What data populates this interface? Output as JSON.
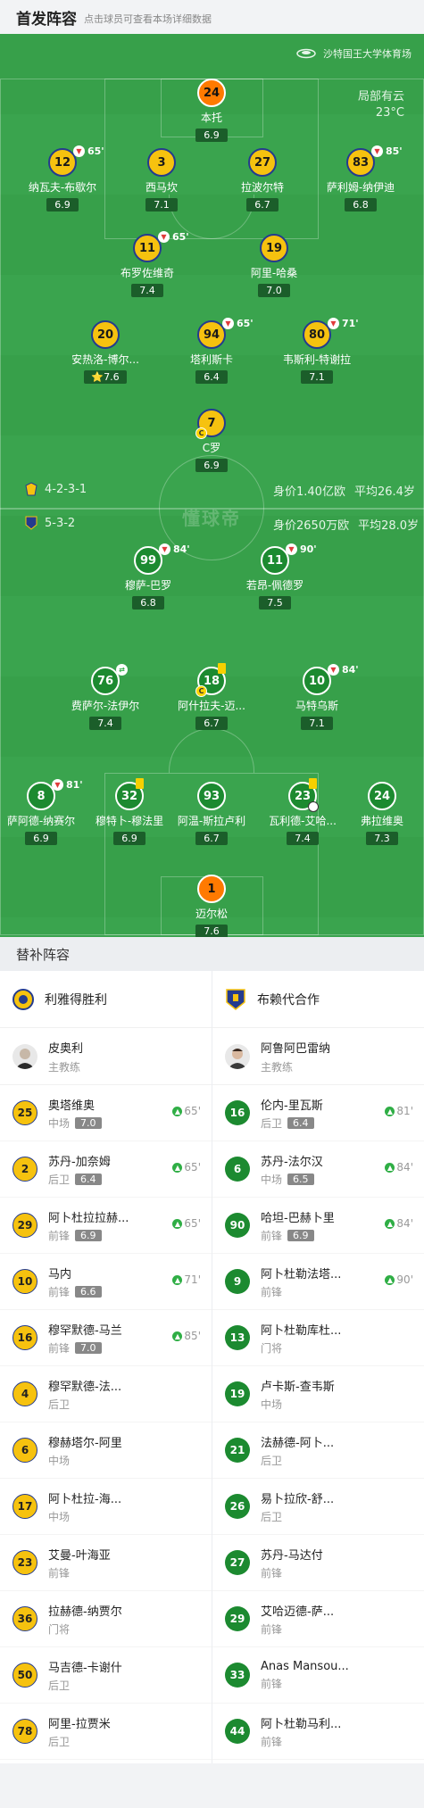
{
  "header": {
    "title": "首发阵容",
    "subtitle": "点击球员可查看本场详细数据"
  },
  "venue": {
    "name": "沙特国王大学体育场",
    "weather": "局部有云",
    "temp": "23°C"
  },
  "watermark": "懂球帝",
  "home_team": {
    "formation": "4-2-3-1",
    "value": "身价1.40亿欧",
    "age": "平均26.4岁"
  },
  "away_team": {
    "formation": "5-3-2",
    "value": "身价2650万欧",
    "age": "平均28.0岁"
  },
  "pitch_home": [
    {
      "num": "24",
      "name": "本托",
      "rating": "6.9",
      "style": "gk-away"
    },
    {
      "num": "12",
      "name": "纳瓦夫-布歇尔",
      "rating": "6.9",
      "style": "yb",
      "sub": "65'"
    },
    {
      "num": "3",
      "name": "西马坎",
      "rating": "7.1",
      "style": "yb"
    },
    {
      "num": "27",
      "name": "拉波尔特",
      "rating": "6.7",
      "style": "yb"
    },
    {
      "num": "83",
      "name": "萨利姆-纳伊迪",
      "rating": "6.8",
      "style": "yb",
      "sub": "85'"
    },
    {
      "num": "11",
      "name": "布罗佐维奇",
      "rating": "7.4",
      "style": "yb",
      "sub": "65'"
    },
    {
      "num": "19",
      "name": "阿里-哈桑",
      "rating": "7.0",
      "style": "yb"
    },
    {
      "num": "20",
      "name": "安热洛-博尔...",
      "rating": "7.6",
      "style": "yb",
      "star": "true"
    },
    {
      "num": "94",
      "name": "塔利斯卡",
      "rating": "6.4",
      "style": "yb",
      "sub": "65'"
    },
    {
      "num": "80",
      "name": "韦斯利-特谢拉",
      "rating": "7.1",
      "style": "yb",
      "sub": "71'"
    },
    {
      "num": "7",
      "name": "C罗",
      "rating": "6.9",
      "style": "yb",
      "captain": "C"
    }
  ],
  "pitch_away": [
    {
      "num": "99",
      "name": "穆萨-巴罗",
      "rating": "6.8",
      "style": "green",
      "sub": "84'"
    },
    {
      "num": "11",
      "name": "若昂-佩德罗",
      "rating": "7.5",
      "style": "green",
      "sub": "90'"
    },
    {
      "num": "76",
      "name": "费萨尔-法伊尔",
      "rating": "7.4",
      "style": "green",
      "subin": "true"
    },
    {
      "num": "18",
      "name": "阿什拉夫-迈...",
      "rating": "6.7",
      "style": "green",
      "captain": "C",
      "card": "true"
    },
    {
      "num": "10",
      "name": "马特乌斯",
      "rating": "7.1",
      "style": "green",
      "sub": "84'"
    },
    {
      "num": "8",
      "name": "萨阿德-纳赛尔",
      "rating": "6.9",
      "style": "green",
      "sub": "81'"
    },
    {
      "num": "32",
      "name": "穆特卜-穆法里",
      "rating": "6.9",
      "style": "green",
      "card": "true"
    },
    {
      "num": "93",
      "name": "阿温-斯拉卢利",
      "rating": "6.7",
      "style": "green"
    },
    {
      "num": "23",
      "name": "瓦利德-艾哈...",
      "rating": "7.4",
      "style": "green",
      "card": "true",
      "goal": "true"
    },
    {
      "num": "24",
      "name": "弗拉维奥",
      "rating": "7.3",
      "style": "green"
    },
    {
      "num": "1",
      "name": "迈尔松",
      "rating": "7.6",
      "style": "gk-away"
    }
  ],
  "subs_section": "替补阵容",
  "home_subs": {
    "team": "利雅得胜利",
    "coach": {
      "name": "皮奥利",
      "role": "主教练"
    },
    "players": [
      {
        "num": "25",
        "name": "奥塔维奥",
        "pos": "中场",
        "rating": "7.0",
        "time": "65'"
      },
      {
        "num": "2",
        "name": "苏丹-加奈姆",
        "pos": "后卫",
        "rating": "6.4",
        "time": "65'"
      },
      {
        "num": "29",
        "name": "阿卜杜拉拉赫...",
        "pos": "前锋",
        "rating": "6.9",
        "time": "65'"
      },
      {
        "num": "10",
        "name": "马内",
        "pos": "前锋",
        "rating": "6.6",
        "time": "71'"
      },
      {
        "num": "16",
        "name": "穆罕默德-马兰",
        "pos": "前锋",
        "rating": "7.0",
        "time": "85'"
      },
      {
        "num": "4",
        "name": "穆罕默德-法...",
        "pos": "后卫"
      },
      {
        "num": "6",
        "name": "穆赫塔尔-阿里",
        "pos": "中场"
      },
      {
        "num": "17",
        "name": "阿卜杜拉-海...",
        "pos": "中场"
      },
      {
        "num": "23",
        "name": "艾曼-叶海亚",
        "pos": "前锋"
      },
      {
        "num": "36",
        "name": "拉赫德-纳贾尔",
        "pos": "门将"
      },
      {
        "num": "50",
        "name": "马吉德-卡谢什",
        "pos": "后卫"
      },
      {
        "num": "78",
        "name": "阿里-拉贾米",
        "pos": "后卫"
      }
    ]
  },
  "away_subs": {
    "team": "布赖代合作",
    "coach": {
      "name": "阿鲁阿巴雷纳",
      "role": "主教练"
    },
    "players": [
      {
        "num": "16",
        "name": "伦内-里瓦斯",
        "pos": "后卫",
        "rating": "6.4",
        "time": "81'"
      },
      {
        "num": "6",
        "name": "苏丹-法尔汉",
        "pos": "中场",
        "rating": "6.5",
        "time": "84'"
      },
      {
        "num": "90",
        "name": "哈坦-巴赫卜里",
        "pos": "前锋",
        "rating": "6.9",
        "time": "84'"
      },
      {
        "num": "9",
        "name": "阿卜杜勒法塔...",
        "pos": "前锋",
        "time": "90'"
      },
      {
        "num": "13",
        "name": "阿卜杜勒库杜...",
        "pos": "门将"
      },
      {
        "num": "19",
        "name": "卢卡斯-查韦斯",
        "pos": "中场"
      },
      {
        "num": "21",
        "name": "法赫德-阿卜...",
        "pos": "后卫"
      },
      {
        "num": "26",
        "name": "易卜拉欣-舒...",
        "pos": "后卫"
      },
      {
        "num": "27",
        "name": "苏丹-马达付",
        "pos": "前锋"
      },
      {
        "num": "29",
        "name": "艾哈迈德-萨...",
        "pos": "前锋"
      },
      {
        "num": "33",
        "name": "Anas Mansou...",
        "pos": "前锋"
      },
      {
        "num": "44",
        "name": "阿卜杜勒马利...",
        "pos": "前锋"
      }
    ]
  },
  "colors": {
    "pitch": "#3aa44e",
    "home": "#f6c20f",
    "away": "#1c8a30"
  }
}
